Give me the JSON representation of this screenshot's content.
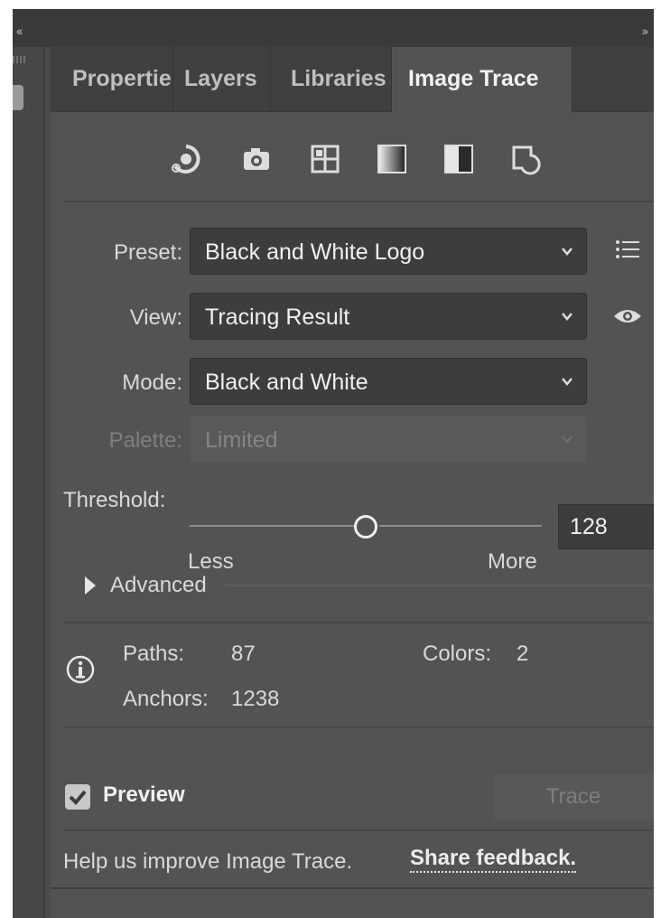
{
  "tabs": [
    {
      "label": "Properties"
    },
    {
      "label": "Layers"
    },
    {
      "label": "Libraries"
    },
    {
      "label": "Image Trace"
    }
  ],
  "window": {
    "collapse_left": "‹‹",
    "collapse_right": "››"
  },
  "toolbar_icons": [
    "auto-color-icon",
    "camera-icon",
    "grid-icon",
    "gradient-icon",
    "split-square-icon",
    "outline-icon"
  ],
  "preset": {
    "label": "Preset:",
    "value": "Black and White Logo"
  },
  "view": {
    "label": "View:",
    "value": "Tracing Result"
  },
  "mode": {
    "label": "Mode:",
    "value": "Black and White"
  },
  "palette": {
    "label": "Palette:",
    "value": "Limited",
    "disabled": true
  },
  "threshold": {
    "label": "Threshold:",
    "value": "128",
    "min_label": "Less",
    "max_label": "More",
    "slider_fraction": 0.5
  },
  "advanced": {
    "label": "Advanced"
  },
  "stats": {
    "paths_label": "Paths:",
    "paths_value": "87",
    "colors_label": "Colors:",
    "colors_value": "2",
    "anchors_label": "Anchors:",
    "anchors_value": "1238"
  },
  "preview": {
    "label": "Preview",
    "checked": true
  },
  "trace_button": {
    "label": "Trace",
    "disabled": true
  },
  "feedback": {
    "text": "Help us improve Image Trace.",
    "link": "Share feedback."
  }
}
